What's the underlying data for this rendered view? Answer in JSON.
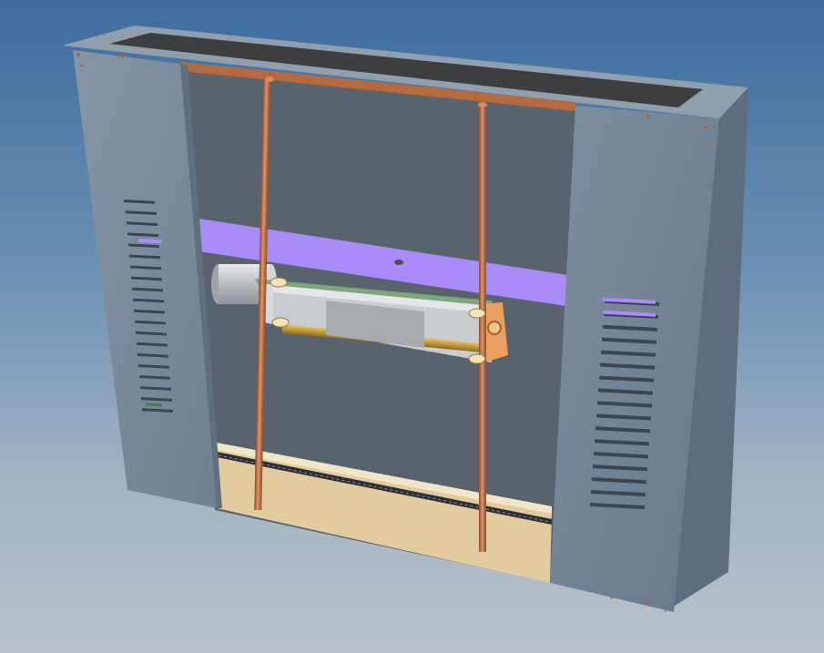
{
  "scene": {
    "description_free": true,
    "colors": {
      "background_top": "#3d6c9e",
      "background_bottom": "#b9c2cb",
      "housing_front": "#7a8c9c",
      "housing_side": "#6d7e8e",
      "inner_back_wall": "#58636d",
      "top_opening": "#3f4042",
      "top_rim": "#8c9cab",
      "copper_rod": "#b86a3c",
      "purple_band": "#a98cf7",
      "green_plate": "#7ea67c",
      "tan_floor": "#e1c99c",
      "motor_silver": "#c4c7cb",
      "brass_screw": "#c8a23c"
    },
    "icons": [
      "housing-enclosure",
      "copper-rod",
      "linear-actuator",
      "motor",
      "vent-slots"
    ]
  }
}
